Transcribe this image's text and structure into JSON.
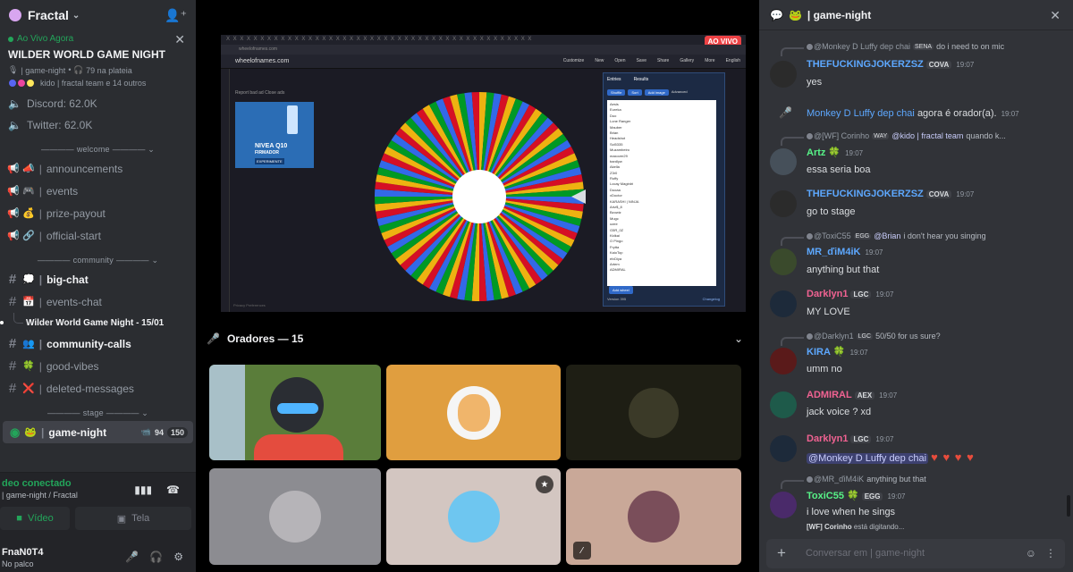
{
  "server": {
    "name": "Fractal",
    "icon": "fractal-logo"
  },
  "event": {
    "live_label": "Ao Vivo Agora",
    "title": "WILDER WORLD GAME NIGHT",
    "channel": "| game-night",
    "audience": "79 na plateia",
    "attendees": "kido | fractal team e 14 outros"
  },
  "stats": [
    {
      "label": "Discord: 62.0K"
    },
    {
      "label": "Twitter: 62.0K"
    }
  ],
  "categories": {
    "welcome": "welcome",
    "community": "community",
    "stage": "stage"
  },
  "channels_welcome": [
    {
      "emoji": "📣",
      "name": "announcements"
    },
    {
      "emoji": "🎮",
      "name": "events"
    },
    {
      "emoji": "💰",
      "name": "prize-payout"
    },
    {
      "emoji": "🔗",
      "name": "official-start"
    }
  ],
  "channels_community": [
    {
      "emoji": "💭",
      "name": "big-chat"
    },
    {
      "emoji": "📅",
      "name": "events-chat"
    }
  ],
  "thread_name": "Wilder World Game Night - 15/01",
  "channels_community2": [
    {
      "emoji": "👥",
      "name": "community-calls"
    },
    {
      "emoji": "🍀",
      "name": "good-vibes"
    },
    {
      "emoji": "❌",
      "name": "deleted-messages"
    }
  ],
  "stage_channel": {
    "name": "game-night",
    "video_count": "94",
    "listeners": "150"
  },
  "voice": {
    "status": "deo conectado",
    "location": "| game-night / Fractal",
    "video_label": "Vídeo",
    "screen_label": "Tela"
  },
  "user": {
    "name": "FnaN0T4",
    "status": "No palco"
  },
  "screen": {
    "tab_strip": "X X X X X X X X X X X X X X X X X X X X X X X X X X X X X X X X X X X X X X X X X X X X X",
    "live_badge": "AO VIVO",
    "url": "wheelofnames.com",
    "site_logo": "wheelofnames.com",
    "site_menu": [
      "Customize",
      "New",
      "Open",
      "Save",
      "Share",
      "Gallery",
      "More",
      "English"
    ],
    "ad_report": "Report bad ad   Close ads",
    "ad_brand": "NIVEA Q10",
    "ad_sub": "FIRMADOR",
    "ad_cta": "EXPERIMENTE",
    "entries_tab": "Entries",
    "results_tab": "Results",
    "shuffle": "Shuffle",
    "sort": "Sort",
    "add_image": "Add image",
    "advanced": "Advanced",
    "entries": [
      "Aesis",
      "Eureka",
      "Duo",
      "Lone Ranger",
      "Mauber",
      "Brian",
      "Headshot",
      "Sci5335",
      "Muzambeiro",
      "maxover29",
      "bardlyw",
      "Akella",
      "Z3r0",
      "Ruffy",
      "Locay Magirdri",
      "Duoaa",
      "xDoctor",
      "KARASHI | NINJA",
      "Artz$_8",
      "Bzowiz",
      "Mugc",
      "ozee",
      "G5R_0Z",
      "Kidkai",
      "O Pingo",
      "Frytta",
      "KaioTop",
      "elvDiya",
      "Artem",
      "ADMIRAL"
    ],
    "add_wheel": "Add wheel",
    "version": "Version 395",
    "changelog": "Changelog",
    "footer": "Privacy Preferences",
    "wheel_colors": [
      "#3369e8",
      "#d50f25",
      "#eeb211",
      "#009925"
    ]
  },
  "speakers": {
    "label": "Oradores — 15"
  },
  "tile_colors": [
    "#5a7d3a",
    "#e09e3f",
    "#1e1e14",
    "#8c8c91",
    "#d3c6c1",
    "#c9a898"
  ],
  "chat": {
    "channel": "| game-night",
    "input_placeholder": "Conversar em  | game-night",
    "typing_name": "[WF] Corinho",
    "typing_suffix": "está digitando..."
  },
  "messages": [
    {
      "reply_name": "@Monkey D Luffy dep chai",
      "reply_tag": "SENA",
      "reply_text": "do i need to on mic",
      "name": "THEFUCKINGJOKERZSZ",
      "tag": "COVA",
      "time": "19:07",
      "text": "yes",
      "color": "#5da8ff",
      "avatar": "#2b2b2b"
    },
    {
      "system_name": "Monkey D Luffy dep chai",
      "system_text": "agora é orador(a).",
      "time": "19:07"
    },
    {
      "reply_name": "@[WF] Corinho",
      "reply_tag": "WAY",
      "reply_mention": "@kido | fractal team",
      "reply_text": "quando k...",
      "name": "Artz",
      "badge": "🍀",
      "time": "19:07",
      "text": "essa seria boa",
      "color": "#57f287",
      "avatar": "#46505a"
    },
    {
      "name": "THEFUCKINGJOKERZSZ",
      "tag": "COVA",
      "time": "19:07",
      "text": "go to stage",
      "color": "#5da8ff",
      "avatar": "#2b2b2b"
    },
    {
      "reply_name": "@ToxiC55",
      "reply_tag": "EGG",
      "reply_mention": "@Brian",
      "reply_text": "i don't hear you singing",
      "name": "MR_ďiM4iK",
      "time": "19:07",
      "text": "anything but that",
      "color": "#5da8ff",
      "avatar": "#3a4a2c"
    },
    {
      "name": "Darklyn1",
      "tag": "LGC",
      "time": "19:07",
      "text": "MY LOVE",
      "color": "#f06292",
      "avatar": "#1d2a3a"
    },
    {
      "reply_name": "@Darklyn1",
      "reply_tag": "LGC",
      "reply_text": "50/50 for us sure?",
      "name": "KIRA",
      "badge": "🍀",
      "time": "19:07",
      "text": "umm no",
      "color": "#5da8ff",
      "avatar": "#5a1a1a"
    },
    {
      "name": "ADMIRAL",
      "tag": "AEX",
      "time": "19:07",
      "text": "jack voice ? xd",
      "color": "#f06292",
      "avatar": "#1e5a4a"
    },
    {
      "name": "Darklyn1",
      "tag": "LGC",
      "time": "19:07",
      "mention": "@Monkey D Luffy dep chai",
      "text": "♥ ♥ ♥ ♥",
      "color": "#f06292",
      "avatar": "#1d2a3a"
    },
    {
      "reply_name": "@MR_ďiM4iK",
      "reply_text": "anything but that",
      "name": "ToxiC55",
      "tag": "EGG",
      "badge": "🍀",
      "time": "19:07",
      "text": "i love when he sings",
      "color": "#57f287",
      "avatar": "#4a2a6a"
    }
  ]
}
